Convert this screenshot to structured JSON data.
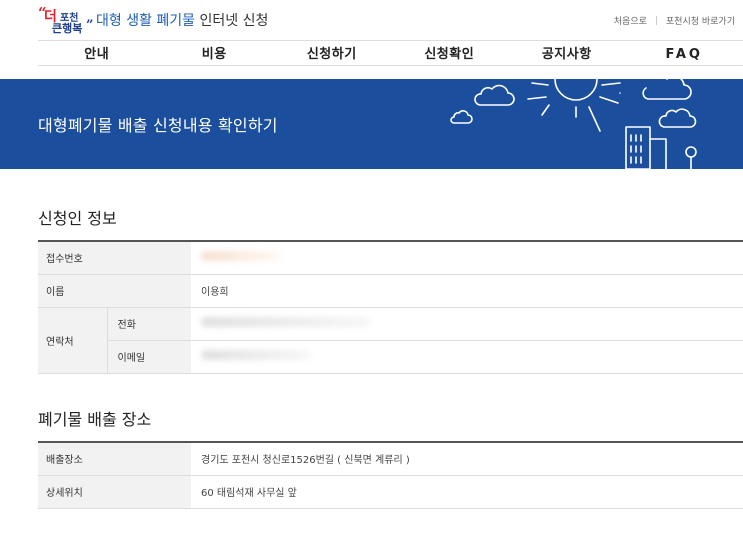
{
  "header": {
    "logo_quote_open": "“",
    "logo_deo": "더",
    "logo_pocheon": "포천",
    "logo_keun": "큰행복",
    "logo_quote_close": "”",
    "title_blue": "대형 생활 폐기물",
    "title_rest": " 인터넷 신청",
    "util_home": "처음으로",
    "util_city": "포천시청 바로가기"
  },
  "nav": {
    "items": [
      "안내",
      "비용",
      "신청하기",
      "신청확인",
      "공지사항",
      "FAQ"
    ]
  },
  "banner": {
    "title": "대형폐기물 배출 신청내용 확인하기"
  },
  "applicant": {
    "section_title": "신청인 정보",
    "receipt_label": "접수번호",
    "name_label": "이름",
    "name_value": "이용희",
    "contact_label": "연락처",
    "phone_label": "전화",
    "email_label": "이메일"
  },
  "location": {
    "section_title": "폐기물 배출 장소",
    "place_label": "배출장소",
    "place_value": "경기도 포천시 청신로1526번길 ( 신북면 계류리 )",
    "detail_label": "상세위치",
    "detail_value": "60 태림석재 사무실 앞"
  },
  "colors": {
    "banner_bg": "#1b4f9e",
    "logo_red": "#e8202a",
    "logo_blue": "#1d3f8c"
  }
}
